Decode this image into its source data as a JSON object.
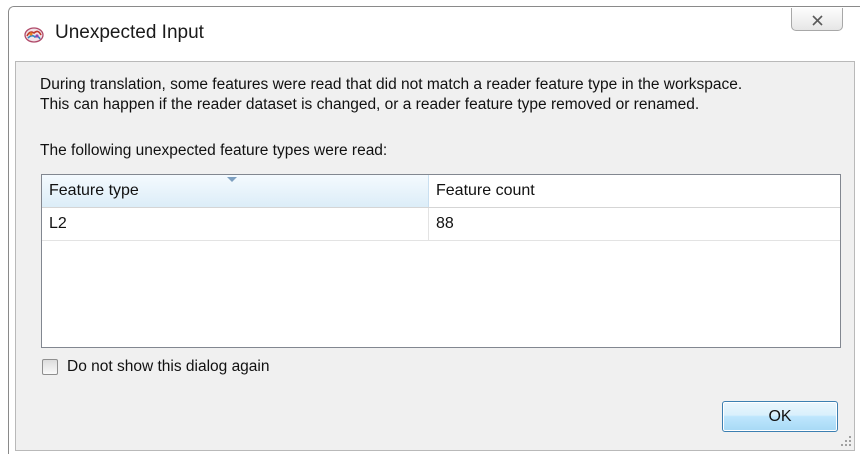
{
  "dialog": {
    "title": "Unexpected Input",
    "app_icon": "app-logo-icon",
    "close_icon": "close-icon"
  },
  "message": {
    "line1": "During translation, some features were read that did not match a reader feature type in the workspace.",
    "line2": "This can happen if the reader dataset is changed, or a reader feature type removed or renamed.",
    "list_intro": "The following unexpected feature types were read:"
  },
  "table": {
    "columns": [
      "Feature type",
      "Feature count"
    ],
    "sorted_column": "Feature type",
    "rows": [
      {
        "feature_type": "L2",
        "feature_count": "88"
      }
    ]
  },
  "options": {
    "dont_show_label": "Do not show this dialog again",
    "dont_show_checked": false
  },
  "buttons": {
    "ok_label": "OK"
  },
  "colors": {
    "header_highlight": "#dcedf8",
    "ok_button_blue": "#a7d9f5",
    "client_background": "#f0f0f0"
  }
}
